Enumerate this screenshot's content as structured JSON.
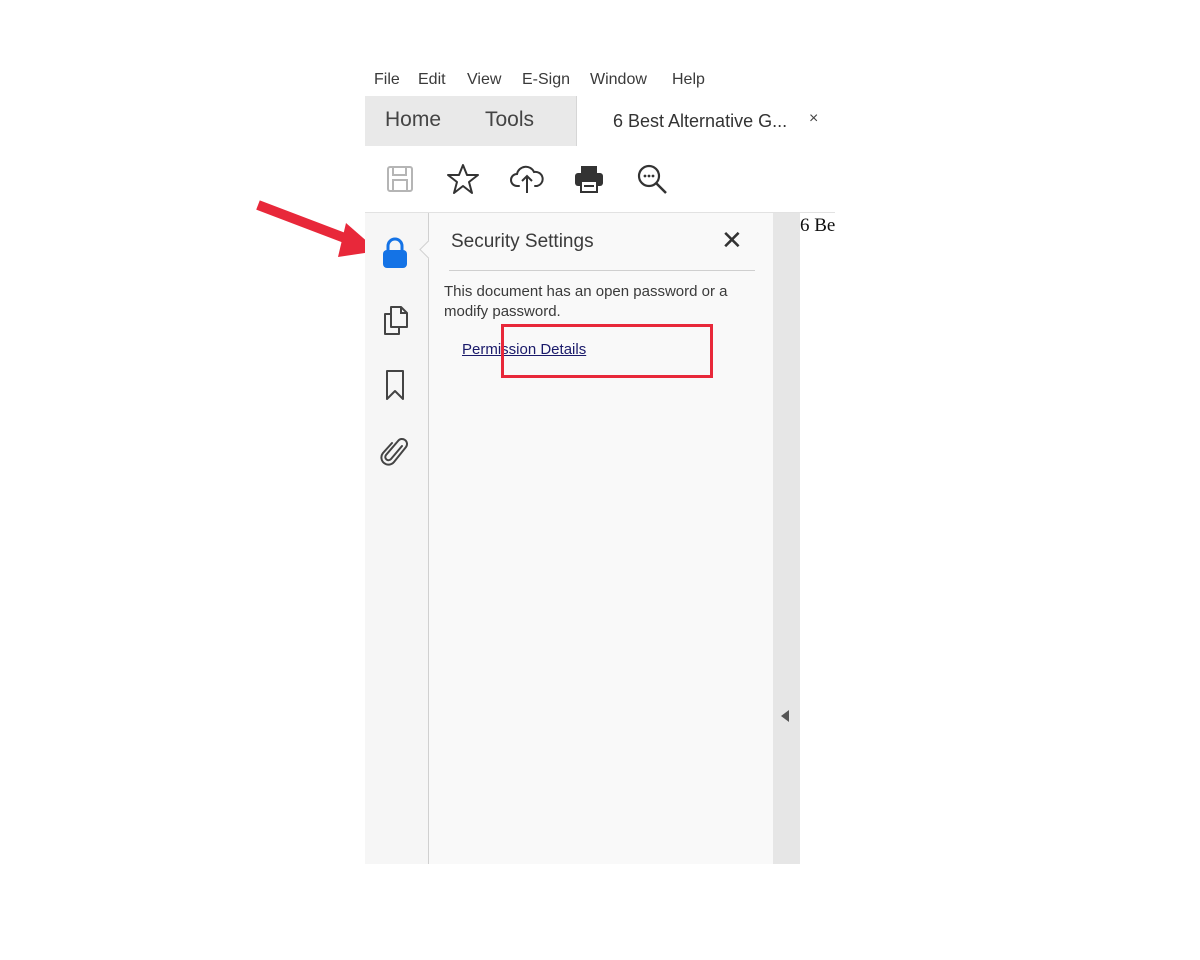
{
  "menu": [
    "File",
    "Edit",
    "View",
    "E-Sign",
    "Window",
    "Help"
  ],
  "tabs": {
    "home": "Home",
    "tools": "Tools",
    "document": "6 Best Alternative G...",
    "close": "×"
  },
  "toolbar": {
    "icons": [
      "save-icon",
      "star-icon",
      "cloud-upload-icon",
      "print-icon",
      "search-zoom-icon"
    ]
  },
  "sidebar": {
    "icons": [
      "lock-icon",
      "pages-icon",
      "bookmark-icon",
      "attachment-icon"
    ],
    "accent": "#1473e6"
  },
  "security_panel": {
    "title": "Security Settings",
    "close": "✕",
    "description": "This document has an open password or a modify password.",
    "link": "Permission Details"
  },
  "document": {
    "visible_text": "6 Be"
  },
  "annotation": {
    "color": "#e8283a"
  }
}
